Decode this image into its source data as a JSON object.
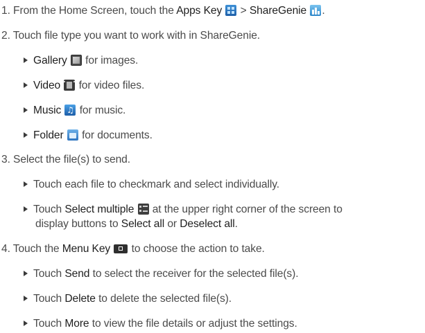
{
  "step1": {
    "num": "1.",
    "a": "From the Home Screen, touch the",
    "apps": "Apps Key",
    "sep": ">",
    "sharegenie": "ShareGenie",
    "end": "."
  },
  "step2": {
    "text": "2. Touch file type you want to work with in ShareGenie.",
    "items": [
      {
        "label": "Gallery",
        "icon": "gallery-icon",
        "desc": "for images."
      },
      {
        "label": "Video",
        "icon": "video-icon",
        "desc": "for video files."
      },
      {
        "label": "Music",
        "icon": "music-icon",
        "desc": "for music."
      },
      {
        "label": "Folder",
        "icon": "folder-icon",
        "desc": "for documents."
      }
    ]
  },
  "step3": {
    "text": "3. Select the file(s) to send.",
    "item1": "Touch each file to checkmark and select individually.",
    "item2": {
      "a": "Touch",
      "select_multiple": "Select multiple",
      "b": "at the upper right corner of the screen to",
      "c": "display buttons to",
      "select_all": "Select all",
      "or": "or",
      "deselect_all": "Deselect all",
      "end": "."
    }
  },
  "step4": {
    "a": "4. Touch the",
    "menu_key": "Menu Key",
    "b": "to choose the action to take.",
    "items": [
      {
        "pre": "Touch",
        "label": "Send",
        "desc": "to select the receiver for the selected file(s)."
      },
      {
        "pre": "Touch",
        "label": "Delete",
        "desc": "to delete the selected file(s)."
      },
      {
        "pre": "Touch",
        "label": "More",
        "desc": "to view the file details or adjust the settings."
      }
    ]
  },
  "icons": {
    "apps": "apps-key-icon",
    "sharegenie": "sharegenie-icon",
    "select_multiple": "select-multiple-icon",
    "menu_key": "menu-key-icon"
  }
}
